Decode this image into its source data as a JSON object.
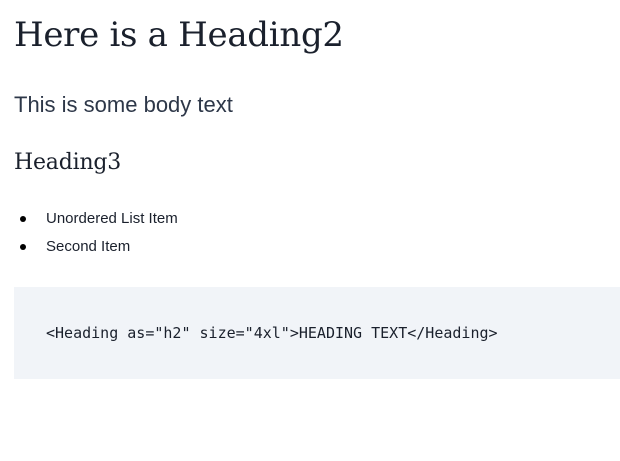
{
  "heading2": "Here is a Heading2",
  "body_text": "This is some body text",
  "heading3": "Heading3",
  "list": {
    "items": [
      {
        "label": "Unordered List Item"
      },
      {
        "label": "Second Item"
      }
    ]
  },
  "code": {
    "text": "<Heading as=\"h2\" size=\"4xl\">HEADING TEXT</Heading>"
  },
  "colors": {
    "code_background": "#f1f4f8",
    "text": "#1a202c"
  }
}
